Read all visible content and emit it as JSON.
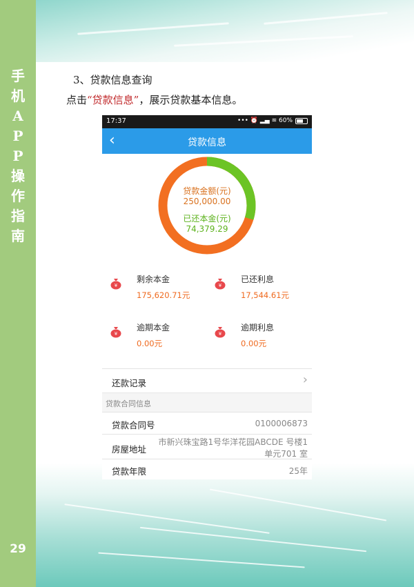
{
  "sidebar": {
    "title_chars": [
      "手",
      "机",
      "A",
      "P",
      "P",
      "操",
      "作",
      "指",
      "南"
    ],
    "page_number": "29"
  },
  "doc": {
    "heading": "3、贷款信息查询",
    "instruction_prefix": "点击",
    "instruction_highlight": "“贷款信息”",
    "instruction_suffix": "，展示贷款基本信息。"
  },
  "phone": {
    "status": {
      "time": "17:37",
      "icons_text": "••• ⏰ ▂▄ ≋ 60%"
    },
    "nav": {
      "back_icon": "‹",
      "title": "贷款信息"
    },
    "donut": {
      "loan_amount_label": "贷款金额(元)",
      "loan_amount_value": "250,000.00",
      "repaid_label": "已还本金(元)",
      "repaid_value": "74,379.29",
      "repaid_fraction": 0.2975,
      "repaid_color": "#6cc425",
      "remaining_color": "#f26f21"
    },
    "stats": [
      {
        "label": "剩余本金",
        "value": "175,620.71元"
      },
      {
        "label": "已还利息",
        "value": "17,544.61元"
      },
      {
        "label": "逾期本金",
        "value": "0.00元"
      },
      {
        "label": "逾期利息",
        "value": "0.00元"
      }
    ],
    "repayment_record": {
      "label": "还款记录",
      "chevron": "›"
    },
    "contract_section": "贷款合同信息",
    "contract": {
      "number_label": "贷款合同号",
      "number_value": "0100006873",
      "address_label": "房屋地址",
      "address_line1": "市新兴珠宝路1号华洋花园ABCDE 号楼1",
      "address_line2": "单元701 室",
      "term_label": "贷款年限",
      "term_value": "25年"
    }
  }
}
